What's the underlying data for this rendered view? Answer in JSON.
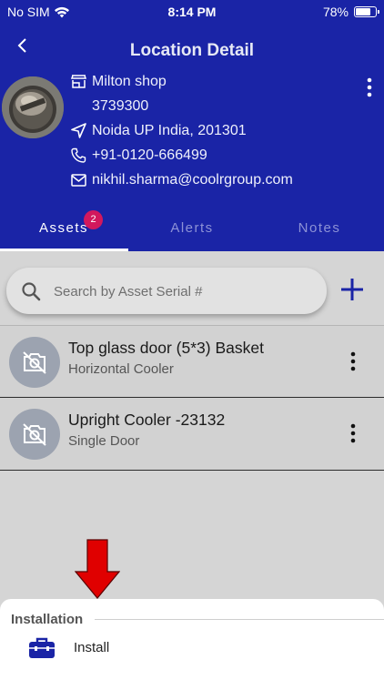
{
  "status_bar": {
    "carrier": "No SIM",
    "time": "8:14 PM",
    "battery": "78%",
    "battery_level": 0.78
  },
  "header": {
    "title": "Location Detail",
    "store_name": "Milton shop",
    "store_code": "3739300",
    "address": "Noida UP India, 201301",
    "phone": "+91-0120-666499",
    "email": "nikhil.sharma@coolrgroup.com"
  },
  "tabs": [
    {
      "label": "Assets",
      "badge": "2",
      "active": true
    },
    {
      "label": "Alerts",
      "active": false
    },
    {
      "label": "Notes",
      "active": false
    }
  ],
  "search": {
    "placeholder": "Search by Asset Serial #"
  },
  "assets": [
    {
      "title": "Top glass door (5*3) Basket",
      "subtitle": "Horizontal Cooler"
    },
    {
      "title": "Upright Cooler -23132",
      "subtitle": "Single Door"
    }
  ],
  "sheet": {
    "title": "Installation",
    "items": [
      {
        "label": "Install",
        "icon": "toolbox-icon"
      }
    ]
  },
  "colors": {
    "primary": "#1a24a6",
    "badge": "#d2185d",
    "arrow": "#e00000",
    "add": "#1a24a6"
  }
}
